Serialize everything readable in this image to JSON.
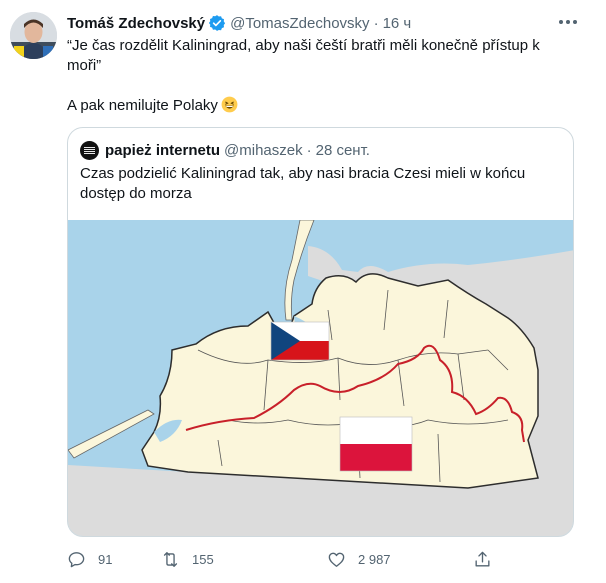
{
  "tweet": {
    "author_name": "Tomáš Zdechovský",
    "author_handle": "@TomasZdechovsky",
    "separator": "·",
    "time": "16 ч",
    "text_line1": "“Je čas rozdělit Kaliningrad, aby naši čeští bratři měli konečně přístup k moři”",
    "text_line2": "A pak nemilujte Polaky"
  },
  "quote": {
    "author_name": "papież internetu",
    "author_handle": "@mihaszek",
    "separator": "·",
    "date": "28 сент.",
    "text": "Czas podzielić Kaliningrad tak, aby nasi bracia Czesi mieli w końcu dostęp do morza"
  },
  "actions": {
    "replies": "91",
    "retweets": "155",
    "likes": "2 987"
  },
  "colors": {
    "sea": "#a9d3ea",
    "land": "#fbf6db",
    "neighbor": "#dcdcdc",
    "border": "#333333",
    "split_line": "#c8202a",
    "verified": "#1d9bf0"
  },
  "icons": [
    "verified-badge-icon",
    "more-icon",
    "grinning-emoji-icon",
    "reply-icon",
    "retweet-icon",
    "like-icon",
    "share-icon"
  ]
}
